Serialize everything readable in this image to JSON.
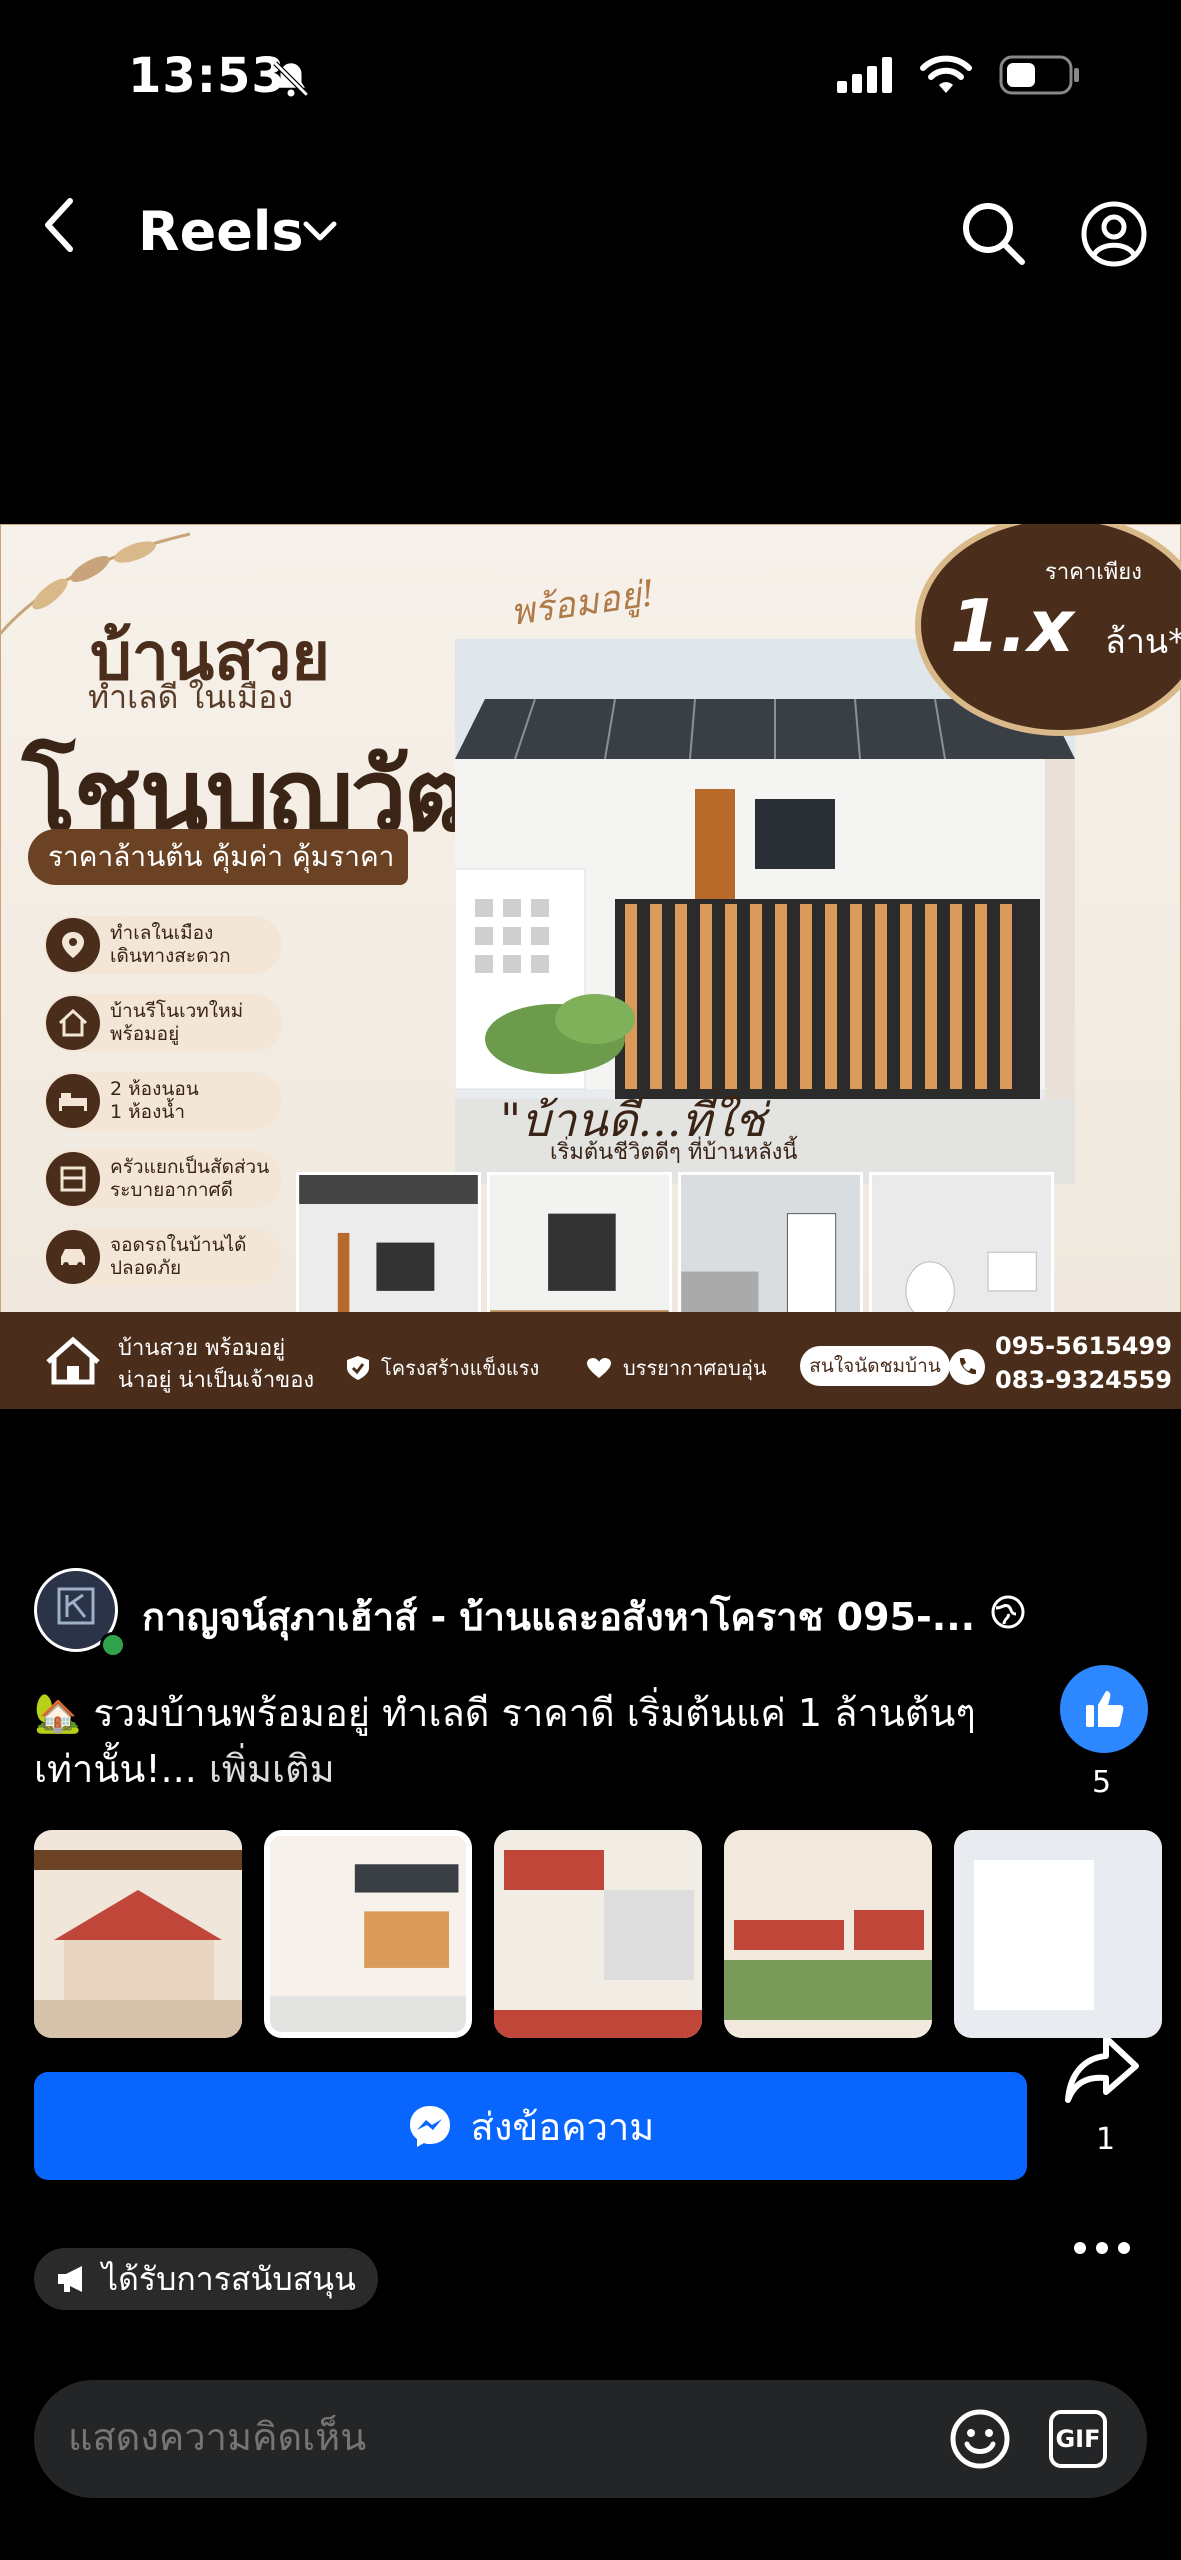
{
  "status_bar": {
    "time": "13:53"
  },
  "nav": {
    "title": "Reels"
  },
  "ad_image": {
    "headline_1": "บ้านสวย",
    "headline_2": "ทำเลดี ในเมือง",
    "headline_3": "โชนบุญวัฒนา",
    "price_banner": "ราคาล้านต้น คุ้มค่า คุ้มราคา",
    "ready_badge": "พร้อมอยู่!",
    "price_label": "ราคาเพียง",
    "price_value": "1.x",
    "price_unit": "ล้าน*",
    "features": [
      {
        "line1": "ทำเลในเมือง",
        "line2": "เดินทางสะดวก"
      },
      {
        "line1": "บ้านรีโนเวทใหม่",
        "line2": "พร้อมอยู่"
      },
      {
        "line1": "2 ห้องนอน",
        "line2": "1 ห้องน้ำ"
      },
      {
        "line1": "ครัวแยกเป็นสัดส่วน",
        "line2": "ระบายอากาศดี"
      },
      {
        "line1": "จอดรถในบ้านได้",
        "line2": "ปลอดภัย"
      }
    ],
    "quote": "\"บ้านดี...ที่ใช่",
    "quote_sub": "เริ่มต้นชีวิตดีๆ ที่บ้านหลังนี้",
    "footer": {
      "line1": "บ้านสวย พร้อมอยู่",
      "line2": "น่าอยู่ น่าเป็นเจ้าของ",
      "item1": "โครงสร้างแข็งแรง",
      "item2": "บรรยากาศอบอุ่น",
      "cta": "สนใจนัดชมบ้าน",
      "phone1": "095-5615499",
      "phone2": "083-9324559"
    }
  },
  "post": {
    "page_name": "กาญจน์สุภาเฮ้าส์ - บ้านและอสังหาโคราช 095-...",
    "caption": "🏡 รวมบ้านพร้อมอยู่ ทำเลดี ราคาดี เริ่มต้นแค่ 1 ล้านต้นๆ เท่านั้น!...",
    "see_more": "เพิ่มเติม",
    "send_message": "ส่งข้อความ",
    "sponsored": "ได้รับการสนับสนุน",
    "comment_placeholder": "แสดงความคิดเห็น",
    "gif_label": "GIF"
  },
  "actions": {
    "like_count": "5",
    "share_count": "1"
  },
  "colors": {
    "accent": "#0866ff",
    "like": "#2d88ff",
    "brown": "#4a2d1a"
  }
}
